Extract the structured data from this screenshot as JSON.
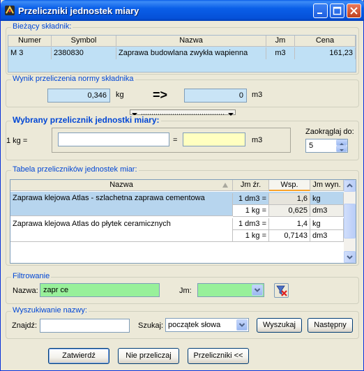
{
  "window": {
    "title": "Przeliczniki jednostek miary"
  },
  "current": {
    "section_label": "Bieżący składnik:",
    "headers": [
      "Numer",
      "Symbol",
      "Nazwa",
      "Jm",
      "Cena"
    ],
    "row": [
      "M 3",
      "2380830",
      "Zaprawa budowlana zwykła wapienna",
      "m3",
      "161,23"
    ]
  },
  "result": {
    "section_label": "Wynik przeliczenia normy składnika",
    "from_value": "0,346",
    "from_unit": "kg",
    "arrow": "=>",
    "to_value": "0",
    "to_unit": "m3"
  },
  "selected": {
    "section_label": "Wybrany przelicznik jednostki miary:",
    "left_label": "1 kg =",
    "mid_input": "",
    "equals": "=",
    "right_input": "",
    "unit": "m3",
    "round_label": "Zaokrąglaj do:",
    "round_value": "5"
  },
  "table": {
    "section_label": "Tabela przeliczników jednostek miar:",
    "headers": [
      "Nazwa",
      "Jm źr.",
      "Wsp.",
      "Jm wyn."
    ],
    "rows": [
      {
        "name": "Zaprawa klejowa Atlas - szlachetna zaprawa cementowa",
        "src": "1 dm3 =",
        "coef": "1,6",
        "unit": "kg",
        "selected": true
      },
      {
        "name": "",
        "src": "1 kg =",
        "coef": "0,625",
        "unit": "dm3",
        "selected": true
      },
      {
        "name": "Zaprawa klejowa Atlas do płytek ceramicznych",
        "src": "1 dm3 =",
        "coef": "1,4",
        "unit": "kg",
        "selected": false
      },
      {
        "name": "",
        "src": "1 kg =",
        "coef": "0,7143",
        "unit": "dm3",
        "selected": false
      }
    ]
  },
  "filter": {
    "section_label": "Filtrowanie",
    "name_label": "Nazwa:",
    "name_value": "zapr ce",
    "jm_label": "Jm:",
    "jm_value": ""
  },
  "search": {
    "section_label": "Wyszukiwanie nazwy:",
    "find_label": "Znajdź:",
    "find_value": "",
    "mode_label": "Szukaj:",
    "mode_value": "początek słowa",
    "search_btn": "Wyszukaj",
    "next_btn": "Następny"
  },
  "footer": {
    "confirm_btn": "Zatwierdź",
    "noconvert_btn": "Nie przeliczaj",
    "converters_btn": "Przeliczniki <<"
  },
  "colors": {
    "highlight_blue": "#bfe0f5",
    "input_blue": "#c9e4f6",
    "selected_row": "#b7d5ee",
    "yellow_input": "#ffffc0",
    "green_input": "#98f09a"
  }
}
